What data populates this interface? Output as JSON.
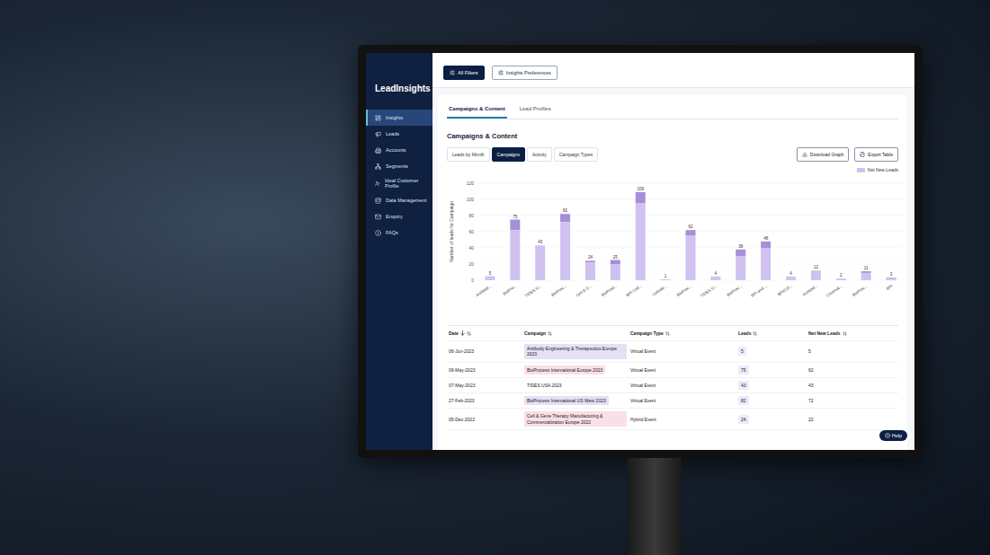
{
  "app": {
    "logo": "LeadInsights"
  },
  "sidebar": {
    "items": [
      {
        "label": "Insights",
        "selected": true
      },
      {
        "label": "Leads",
        "selected": false
      },
      {
        "label": "Accounts",
        "selected": false
      },
      {
        "label": "Segments",
        "selected": false
      },
      {
        "label": "Ideal Customer Profile",
        "selected": false
      },
      {
        "label": "Data Management",
        "selected": false
      },
      {
        "label": "Enquiry",
        "selected": false
      },
      {
        "label": "FAQs",
        "selected": false
      }
    ]
  },
  "toolbar": {
    "buttons": [
      {
        "label": "All Filters",
        "kind": "primary"
      },
      {
        "label": "Insights Preferences",
        "kind": "outline"
      }
    ]
  },
  "tabs": [
    {
      "label": "Campaigns & Content",
      "selected": true
    },
    {
      "label": "Lead Profiles",
      "selected": false
    }
  ],
  "section": {
    "title": "Campaigns & Content"
  },
  "subtabs": [
    {
      "label": "Leads by Month",
      "selected": false
    },
    {
      "label": "Campaigns",
      "selected": true
    },
    {
      "label": "Activity",
      "selected": false
    },
    {
      "label": "Campaign Types",
      "selected": false
    }
  ],
  "actions": [
    "Download Graph",
    "Export Table"
  ],
  "chart": {
    "y_axis": {
      "label": "Number of leads for Campaign",
      "ticks": [
        "0",
        "20",
        "40",
        "60",
        "80",
        "100",
        "120"
      ],
      "max": 120
    },
    "legend": [
      "Net New Leads"
    ],
    "categories": [
      "Antibodi...",
      "BioPro...",
      "TIDES U...",
      "BioProc...",
      "Cell & G...",
      "BioProd...",
      "BPI Coll...",
      "Cellular...",
      "BioProc...",
      "TIDES U...",
      "BioProc...",
      "BPI and ...",
      "BPI/CD...",
      "Antibod...",
      "Chromat...",
      "BioProc...",
      "BPI"
    ],
    "value_labels": [
      "5",
      "75",
      "43",
      "82",
      "24",
      "25",
      "109",
      "1",
      "62",
      "4",
      "38",
      "48",
      "4",
      "12",
      "2",
      "11",
      "3"
    ],
    "series": {
      "leads": [
        5,
        75,
        43,
        82,
        24,
        25,
        109,
        1,
        62,
        4,
        38,
        48,
        4,
        12,
        2,
        11,
        3
      ],
      "net_new_leads": [
        5,
        62,
        43,
        72,
        22,
        20,
        95,
        1,
        55,
        3,
        30,
        40,
        3,
        12,
        2,
        9,
        2
      ]
    }
  },
  "table": {
    "columns": [
      {
        "label": "Date",
        "sorted": true
      },
      {
        "label": "Campaign",
        "sorted": false
      },
      {
        "label": "Campaign Type",
        "sorted": false
      },
      {
        "label": "Leads",
        "sorted": false
      },
      {
        "label": "Net New Leads",
        "sorted": false
      }
    ],
    "rows": [
      {
        "date": "06-Jun-2023",
        "campaign": "Antibody Engineering & Therapeutics Europe 2023",
        "type": "Virtual Event",
        "leads": "5",
        "net_new_leads": "5",
        "color": "#e6e0f7"
      },
      {
        "date": "09-May-2023",
        "campaign": "BioProcess International Europe 2023",
        "type": "Virtual Event",
        "leads": "75",
        "net_new_leads": "62",
        "color": "#f9dfe6"
      },
      {
        "date": "07-May-2023",
        "campaign": "TIDES USA 2023",
        "type": "Virtual Event",
        "leads": "43",
        "net_new_leads": "43",
        "color": "#ffffff"
      },
      {
        "date": "27-Feb-2023",
        "campaign": "BioProcess International US West 2023",
        "type": "Virtual Event",
        "leads": "82",
        "net_new_leads": "72",
        "color": "#e6e0f7"
      },
      {
        "date": "05-Dec-2022",
        "campaign": "Cell & Gene Therapy Manufacturing & Commercialization Europe 2022",
        "type": "Hybrid Event",
        "leads": "24",
        "net_new_leads": "22",
        "color": "#f9dfe6"
      }
    ]
  },
  "help": {
    "label": "Help"
  }
}
